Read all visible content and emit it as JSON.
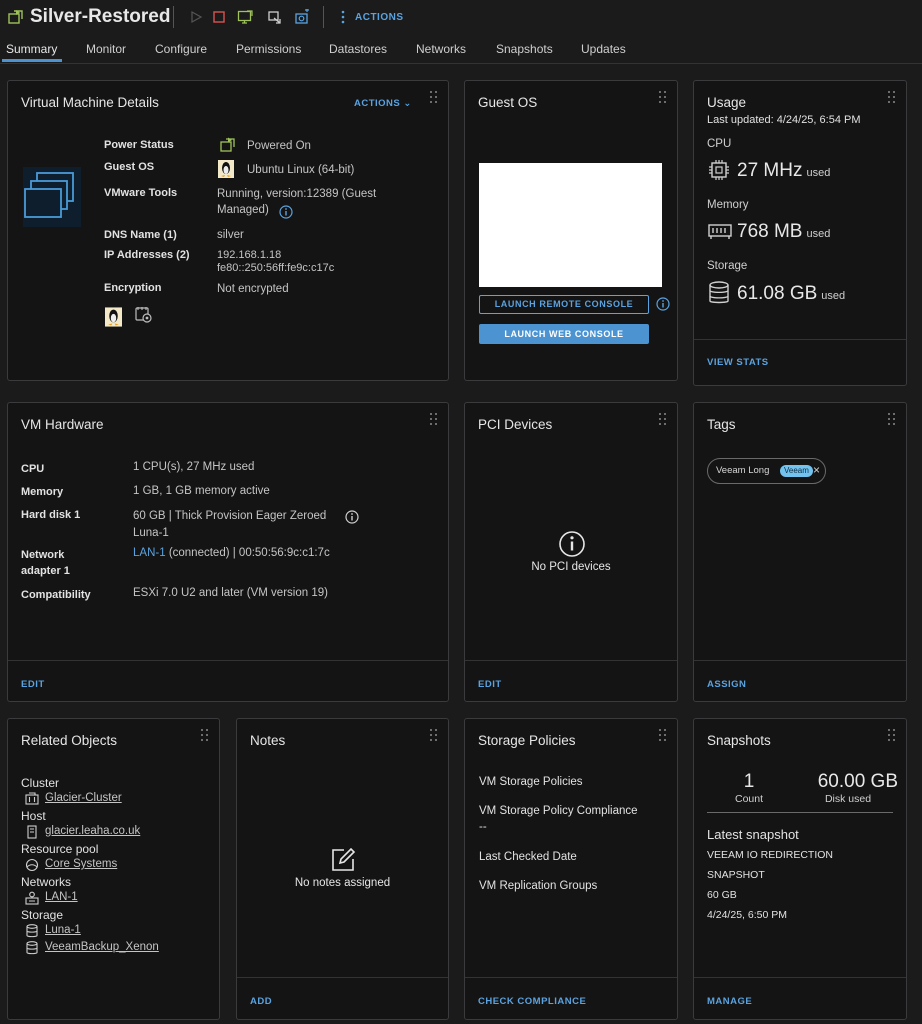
{
  "header": {
    "vm_name": "Silver-Restored",
    "actions_label": "ACTIONS"
  },
  "tabs": [
    "Summary",
    "Monitor",
    "Configure",
    "Permissions",
    "Datastores",
    "Networks",
    "Snapshots",
    "Updates"
  ],
  "vm_details": {
    "title": "Virtual Machine Details",
    "actions_label": "ACTIONS",
    "rows": [
      {
        "label": "Power Status",
        "value": "Powered On"
      },
      {
        "label": "Guest OS",
        "value": "Ubuntu Linux (64-bit)"
      },
      {
        "label": "VMware Tools",
        "value": "Running, version:12389 (Guest",
        "value2": "Managed)"
      },
      {
        "label": "DNS Name (1)",
        "value": "silver"
      },
      {
        "label": "IP Addresses (2)",
        "value": "192.168.1.18",
        "value2": "fe80::250:56ff:fe9c:c17c"
      },
      {
        "label": "Encryption",
        "value": "Not encrypted"
      }
    ]
  },
  "guest_os": {
    "title": "Guest OS",
    "remote_console": "LAUNCH REMOTE CONSOLE",
    "web_console": "LAUNCH WEB CONSOLE"
  },
  "usage": {
    "title": "Usage",
    "last_updated": "Last updated: 4/24/25, 6:54 PM",
    "cpu_label": "CPU",
    "cpu_value": "27 MHz",
    "memory_label": "Memory",
    "memory_value": "768 MB",
    "storage_label": "Storage",
    "storage_value": "61.08 GB",
    "used": "used",
    "view_stats": "VIEW STATS"
  },
  "vm_hardware": {
    "title": "VM Hardware",
    "cpu_label": "CPU",
    "cpu_value": "1 CPU(s), 27 MHz used",
    "memory_label": "Memory",
    "memory_value": "1 GB, 1 GB memory active",
    "disk_label": "Hard disk 1",
    "disk_value": "60 GB | Thick Provision Eager Zeroed",
    "disk_link": "Luna-1",
    "net_label1": "Network",
    "net_label2": "adapter 1",
    "net_link": "LAN-1",
    "net_value": "(connected) | 00:50:56:9c:c1:7c",
    "compat_label": "Compatibility",
    "compat_value": "ESXi 7.0 U2 and later (VM version 19)",
    "edit": "EDIT"
  },
  "pci": {
    "title": "PCI Devices",
    "empty": "No PCI devices",
    "edit": "EDIT"
  },
  "tags": {
    "title": "Tags",
    "tag_name": "Veeam Long",
    "tag_badge": "Veeam",
    "assign": "ASSIGN"
  },
  "related": {
    "title": "Related Objects",
    "cluster_label": "Cluster",
    "cluster": "Glacier-Cluster",
    "host_label": "Host",
    "host": "glacier.leaha.co.uk",
    "pool_label": "Resource pool",
    "pool": "Core Systems",
    "networks_label": "Networks",
    "network": "LAN-1",
    "storage_label": "Storage",
    "storage1": "Luna-1",
    "storage2": "VeeamBackup_Xenon"
  },
  "notes": {
    "title": "Notes",
    "empty": "No notes assigned",
    "add": "ADD"
  },
  "storage_policies": {
    "title": "Storage Policies",
    "vm_policies": "VM Storage Policies",
    "compliance": "VM Storage Policy Compliance",
    "compliance_value": "--",
    "last_checked": "Last Checked Date",
    "replication": "VM Replication Groups",
    "check": "CHECK COMPLIANCE"
  },
  "snapshots": {
    "title": "Snapshots",
    "count": "1",
    "count_label": "Count",
    "disk": "60.00 GB",
    "disk_label": "Disk used",
    "latest": "Latest snapshot",
    "name1": "VEEAM IO REDIRECTION",
    "name2": "SNAPSHOT",
    "size": "60 GB",
    "date": "4/24/25, 6:50 PM",
    "manage": "MANAGE"
  }
}
